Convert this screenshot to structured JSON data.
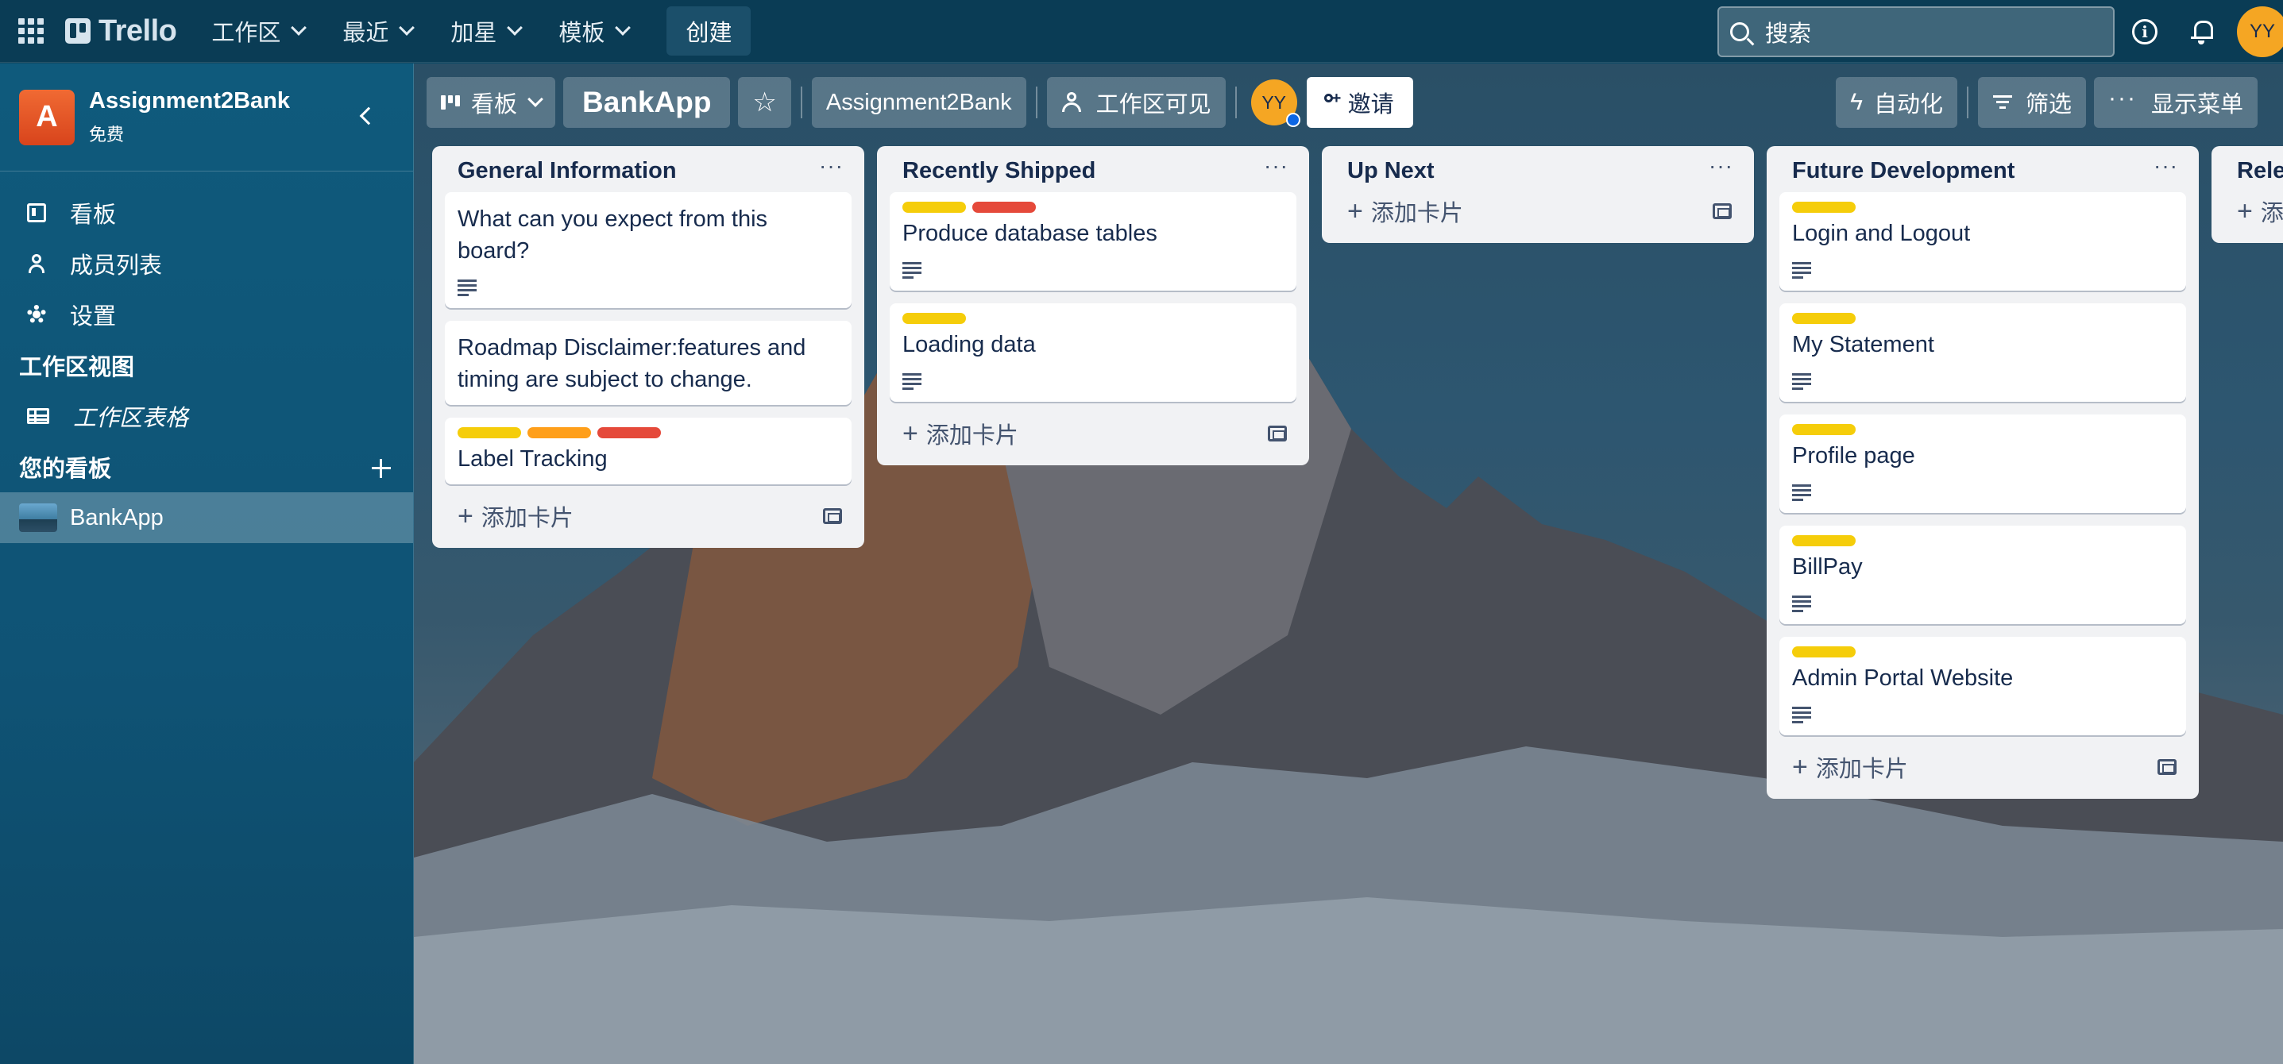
{
  "topbar": {
    "logo": "Trello",
    "menus": [
      "工作区",
      "最近",
      "加星",
      "模板"
    ],
    "create": "创建",
    "search_placeholder": "搜索",
    "avatar": "YY"
  },
  "sidebar": {
    "workspace_initial": "A",
    "workspace_name": "Assignment2Bank",
    "workspace_plan": "免费",
    "items": [
      {
        "label": "看板"
      },
      {
        "label": "成员列表"
      },
      {
        "label": "设置"
      }
    ],
    "views_heading": "工作区视图",
    "views": [
      {
        "label": "工作区表格"
      }
    ],
    "boards_heading": "您的看板",
    "boards": [
      {
        "label": "BankApp"
      }
    ]
  },
  "board": {
    "view_switch": "看板",
    "title": "BankApp",
    "workspace": "Assignment2Bank",
    "visibility": "工作区可见",
    "member_avatar": "YY",
    "invite": "邀请",
    "automation": "自动化",
    "filter": "筛选",
    "show_menu": "显示菜单"
  },
  "colors": {
    "yellow": "#f5cd0a",
    "orange": "#ff9f1a",
    "red": "#e5493a"
  },
  "lists": [
    {
      "title": "General Information",
      "add_card": "添加卡片",
      "cards": [
        {
          "title": "What can you expect from this board?",
          "labels": [],
          "has_description": true
        },
        {
          "title": "Roadmap Disclaimer:features and timing are subject to change.",
          "labels": [],
          "has_description": false
        },
        {
          "title": "Label Tracking",
          "labels": [
            "yellow",
            "orange",
            "red"
          ],
          "has_description": false
        }
      ]
    },
    {
      "title": "Recently Shipped",
      "add_card": "添加卡片",
      "cards": [
        {
          "title": "Produce database tables",
          "labels": [
            "yellow",
            "red"
          ],
          "has_description": true
        },
        {
          "title": "Loading data",
          "labels": [
            "yellow"
          ],
          "has_description": true
        }
      ]
    },
    {
      "title": "Up Next",
      "add_card": "添加卡片",
      "cards": []
    },
    {
      "title": "Future Development",
      "add_card": "添加卡片",
      "cards": [
        {
          "title": "Login and Logout",
          "labels": [
            "yellow"
          ],
          "has_description": true
        },
        {
          "title": "My Statement",
          "labels": [
            "yellow"
          ],
          "has_description": true
        },
        {
          "title": "Profile page",
          "labels": [
            "yellow"
          ],
          "has_description": true
        },
        {
          "title": "BillPay",
          "labels": [
            "yellow"
          ],
          "has_description": true
        },
        {
          "title": "Admin Portal Website",
          "labels": [
            "yellow"
          ],
          "has_description": true
        }
      ]
    },
    {
      "title": "Rele",
      "add_card": "添",
      "cards": []
    }
  ]
}
